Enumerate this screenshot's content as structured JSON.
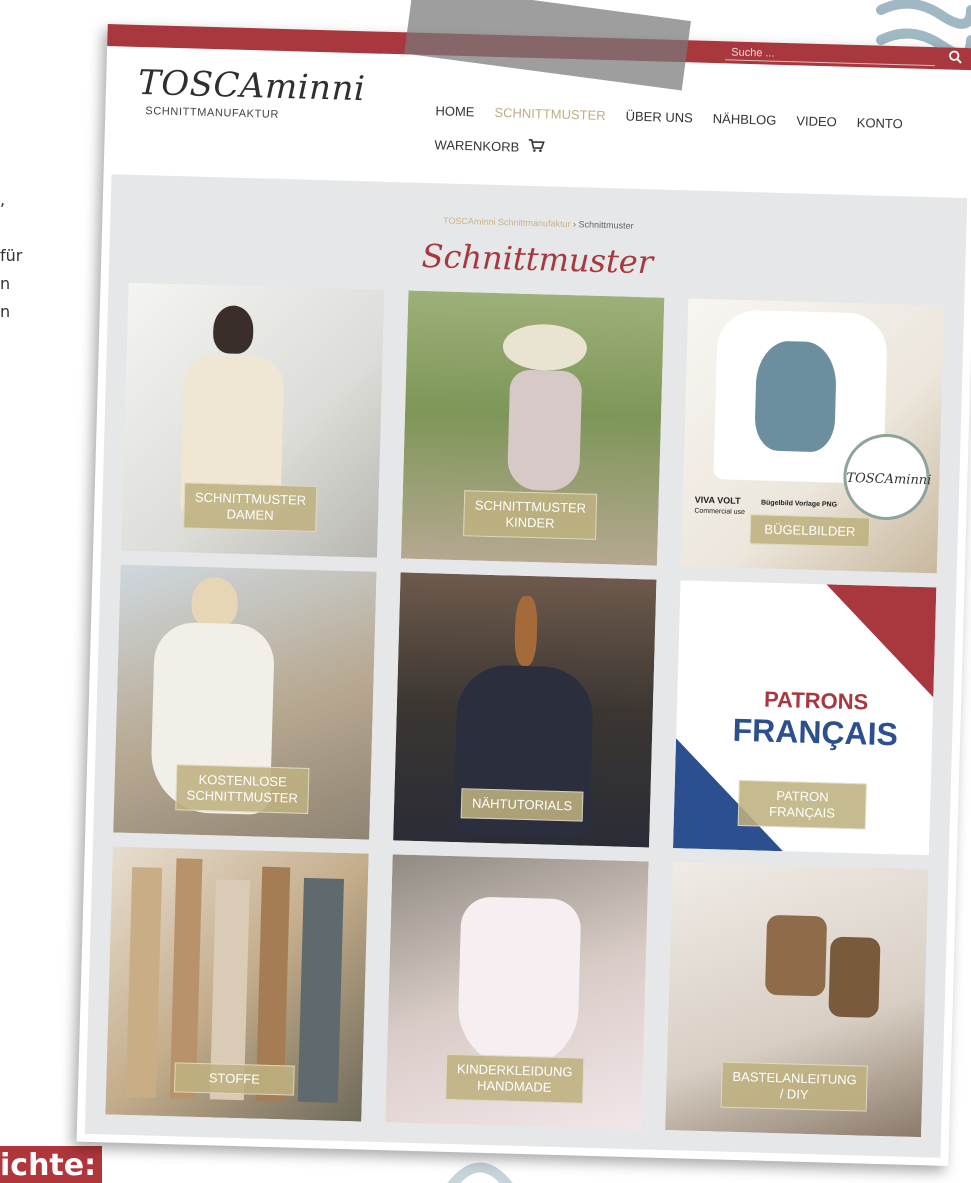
{
  "left_edge": {
    "line1": ",",
    "line2": "für",
    "line3": "n",
    "line4": "n",
    "banner": "ichte:"
  },
  "site": {
    "search_placeholder": "Suche ...",
    "logo_main": "TOSCAminni",
    "logo_sub": "SCHNITTMANUFAKTUR"
  },
  "nav": {
    "items": [
      {
        "label": "HOME"
      },
      {
        "label": "SCHNITTMUSTER"
      },
      {
        "label": "ÜBER UNS"
      },
      {
        "label": "NÄHBLOG"
      },
      {
        "label": "VIDEO"
      },
      {
        "label": "KONTO"
      }
    ],
    "cart_label": "WARENKORB",
    "active_index": 1
  },
  "breadcrumb": {
    "home": "TOSCAminni Schnittmanufaktur",
    "separator": "›",
    "current": "Schnittmuster"
  },
  "page_title": "Schnittmuster",
  "tiles": [
    {
      "label": "SCHNITTMUSTER DAMEN"
    },
    {
      "label": "SCHNITTMUSTER KINDER"
    },
    {
      "label": "BÜGELBILDER"
    },
    {
      "label": "KOSTENLOSE SCHNITTMUSTER"
    },
    {
      "label": "NÄHTUTORIALS"
    },
    {
      "label": "PATRON FRANÇAIS"
    },
    {
      "label": "STOFFE"
    },
    {
      "label": "KINDERKLEIDUNG HANDMADE"
    },
    {
      "label": "BASTELANLEITUNG / DIY"
    }
  ],
  "buegel_image": {
    "caption_left": "VIVA VOLT",
    "caption_right": "Bügelbild Vorlage PNG",
    "caption_small": "Commercial use",
    "badge": "TOSCAminni"
  },
  "patron_image": {
    "line1": "PATRONS",
    "line2": "FRANÇAIS"
  },
  "colors": {
    "brand_red": "#a8383d",
    "gold": "#bfae84",
    "content_bg": "#e5e7e8"
  },
  "icons": {
    "search": "search-icon",
    "cart": "cart-icon"
  }
}
